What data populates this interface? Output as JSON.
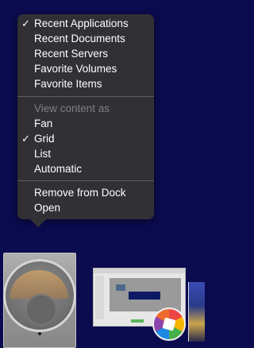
{
  "menu": {
    "items": [
      {
        "label": "Recent Applications",
        "checked": true
      },
      {
        "label": "Recent Documents",
        "checked": false
      },
      {
        "label": "Recent Servers",
        "checked": false
      },
      {
        "label": "Favorite Volumes",
        "checked": false
      },
      {
        "label": "Favorite Items",
        "checked": false
      }
    ],
    "view_header": "View content as",
    "view_items": [
      {
        "label": "Fan",
        "checked": false
      },
      {
        "label": "Grid",
        "checked": true
      },
      {
        "label": "List",
        "checked": false
      },
      {
        "label": "Automatic",
        "checked": false
      }
    ],
    "actions": [
      {
        "label": "Remove from Dock"
      },
      {
        "label": "Open"
      }
    ],
    "check_glyph": "✓"
  },
  "dock": {
    "icons": [
      "applications-stack-icon",
      "window-thumbnail-icon",
      "picasa-icon",
      "partial-window-icon"
    ]
  },
  "colors": {
    "background": "#0b0b4f",
    "menu_bg": "#343434",
    "menu_text": "#ffffff",
    "menu_disabled": "#7f7f7f"
  }
}
